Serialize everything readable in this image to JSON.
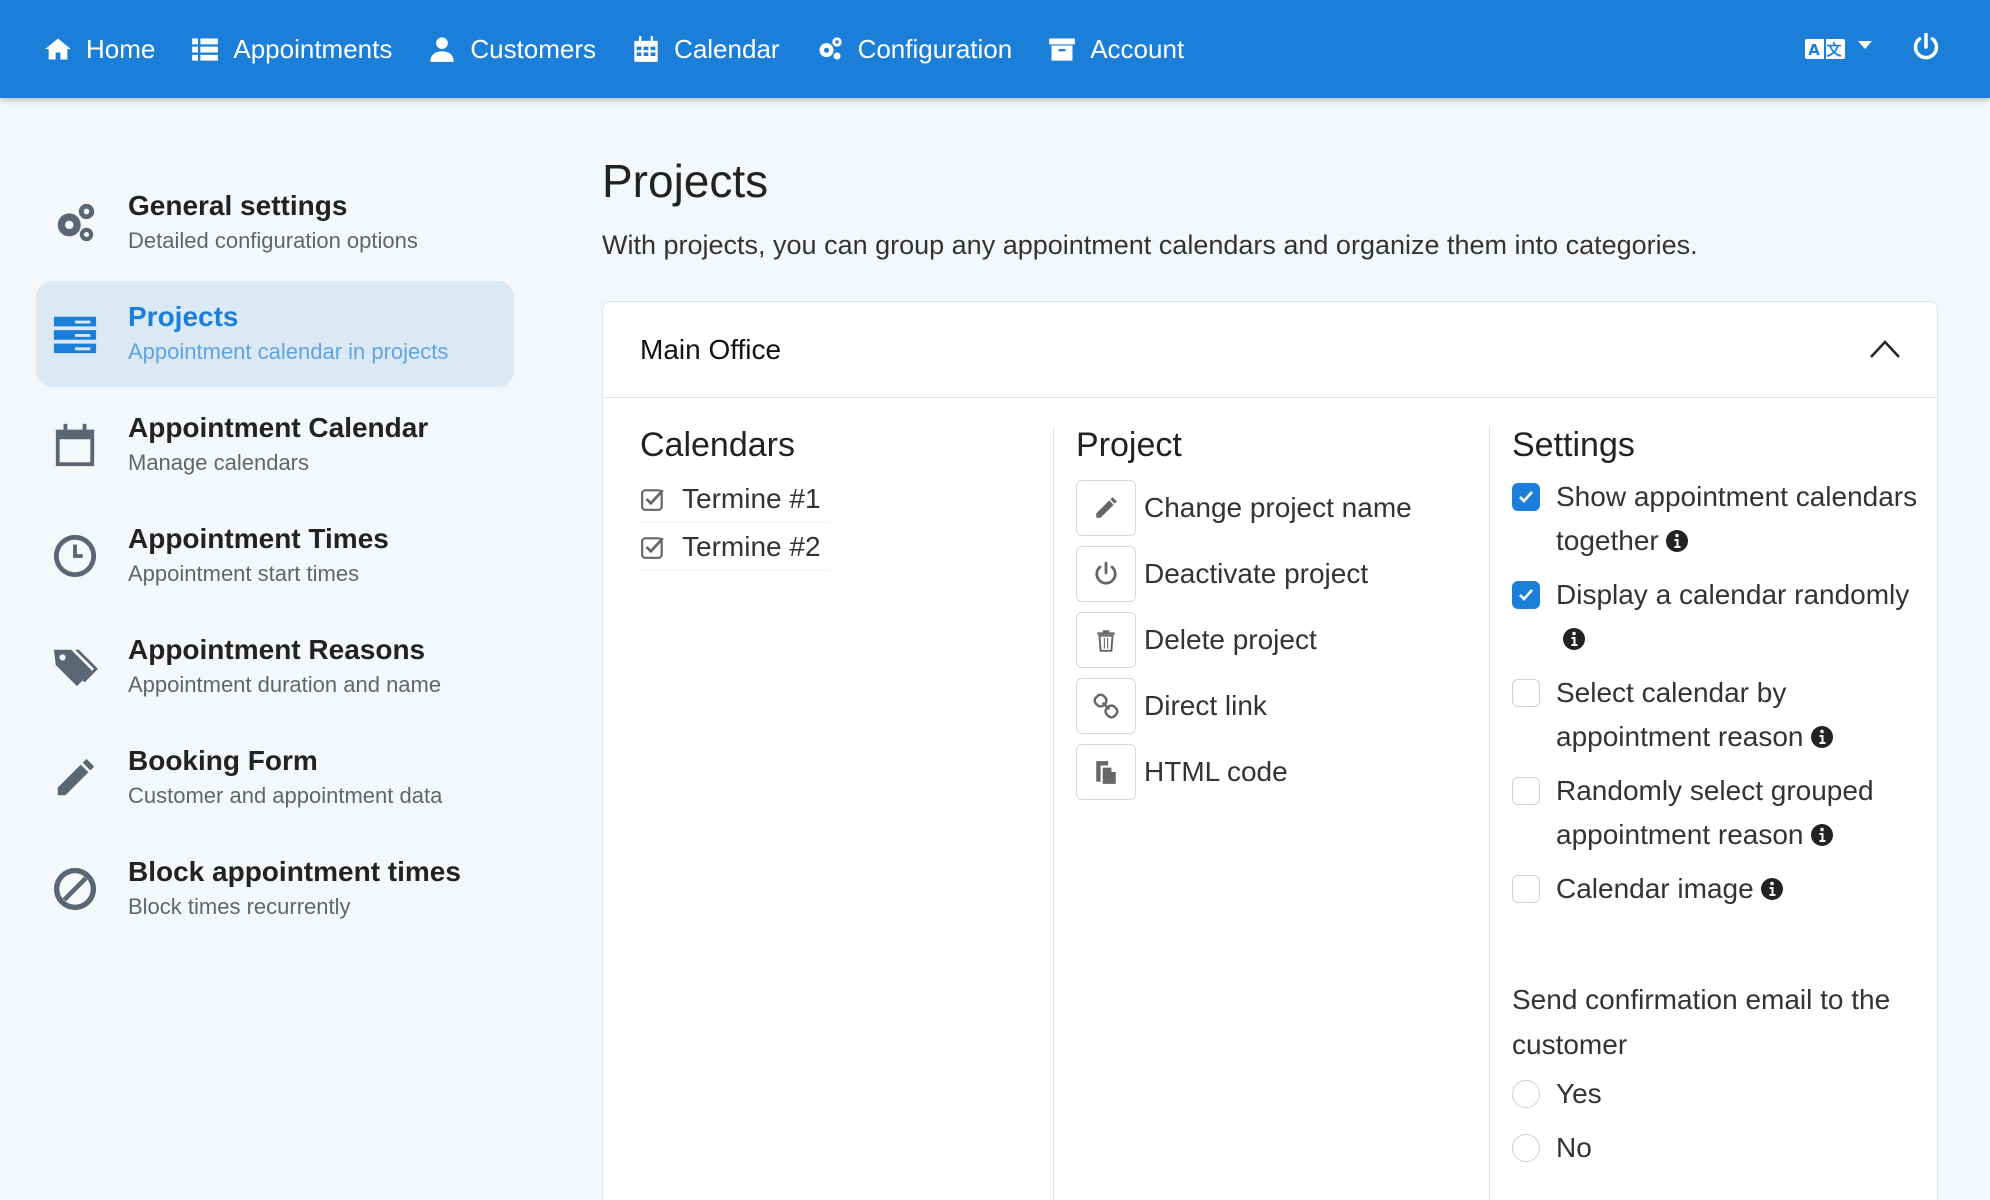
{
  "nav": {
    "items": [
      {
        "label": "Home",
        "icon": "home-icon"
      },
      {
        "label": "Appointments",
        "icon": "list-icon"
      },
      {
        "label": "Customers",
        "icon": "user-icon"
      },
      {
        "label": "Calendar",
        "icon": "calendar-icon"
      },
      {
        "label": "Configuration",
        "icon": "gears-icon"
      },
      {
        "label": "Account",
        "icon": "archive-icon"
      }
    ],
    "accent_color": "#1b7fd9"
  },
  "sidebar": {
    "items": [
      {
        "title": "General settings",
        "subtitle": "Detailed configuration options",
        "icon": "gears-icon",
        "active": false
      },
      {
        "title": "Projects",
        "subtitle": "Appointment calendar in projects",
        "icon": "server-icon",
        "active": true
      },
      {
        "title": "Appointment Calendar",
        "subtitle": "Manage calendars",
        "icon": "calendar-icon",
        "active": false
      },
      {
        "title": "Appointment Times",
        "subtitle": "Appointment start times",
        "icon": "clock-icon",
        "active": false
      },
      {
        "title": "Appointment Reasons",
        "subtitle": "Appointment duration and name",
        "icon": "tags-icon",
        "active": false
      },
      {
        "title": "Booking Form",
        "subtitle": "Customer and appointment data",
        "icon": "pencil-icon",
        "active": false
      },
      {
        "title": "Block appointment times",
        "subtitle": "Block times recurrently",
        "icon": "ban-icon",
        "active": false
      }
    ]
  },
  "main": {
    "title": "Projects",
    "description": "With projects, you can group any appointment calendars and organize them into categories.",
    "card": {
      "title": "Main Office",
      "calendars": {
        "heading": "Calendars",
        "items": [
          "Termine #1",
          "Termine #2"
        ]
      },
      "project": {
        "heading": "Project",
        "actions": [
          {
            "label": "Change project name",
            "icon": "pencil-icon"
          },
          {
            "label": "Deactivate project",
            "icon": "power-icon"
          },
          {
            "label": "Delete project",
            "icon": "trash-icon"
          },
          {
            "label": "Direct link",
            "icon": "link-icon"
          },
          {
            "label": "HTML code",
            "icon": "copy-icon"
          }
        ]
      },
      "settings": {
        "heading": "Settings",
        "options": [
          {
            "label": "Show appointment calendars together",
            "checked": true
          },
          {
            "label": "Display a calendar randomly",
            "checked": true
          },
          {
            "label": "Select calendar by appointment reason",
            "checked": false
          },
          {
            "label": "Randomly select grouped appointment reason",
            "checked": false
          },
          {
            "label": "Calendar image",
            "checked": false
          }
        ],
        "email_label": "Send confirmation email to the customer",
        "email_options": [
          "Yes",
          "No"
        ]
      }
    }
  }
}
